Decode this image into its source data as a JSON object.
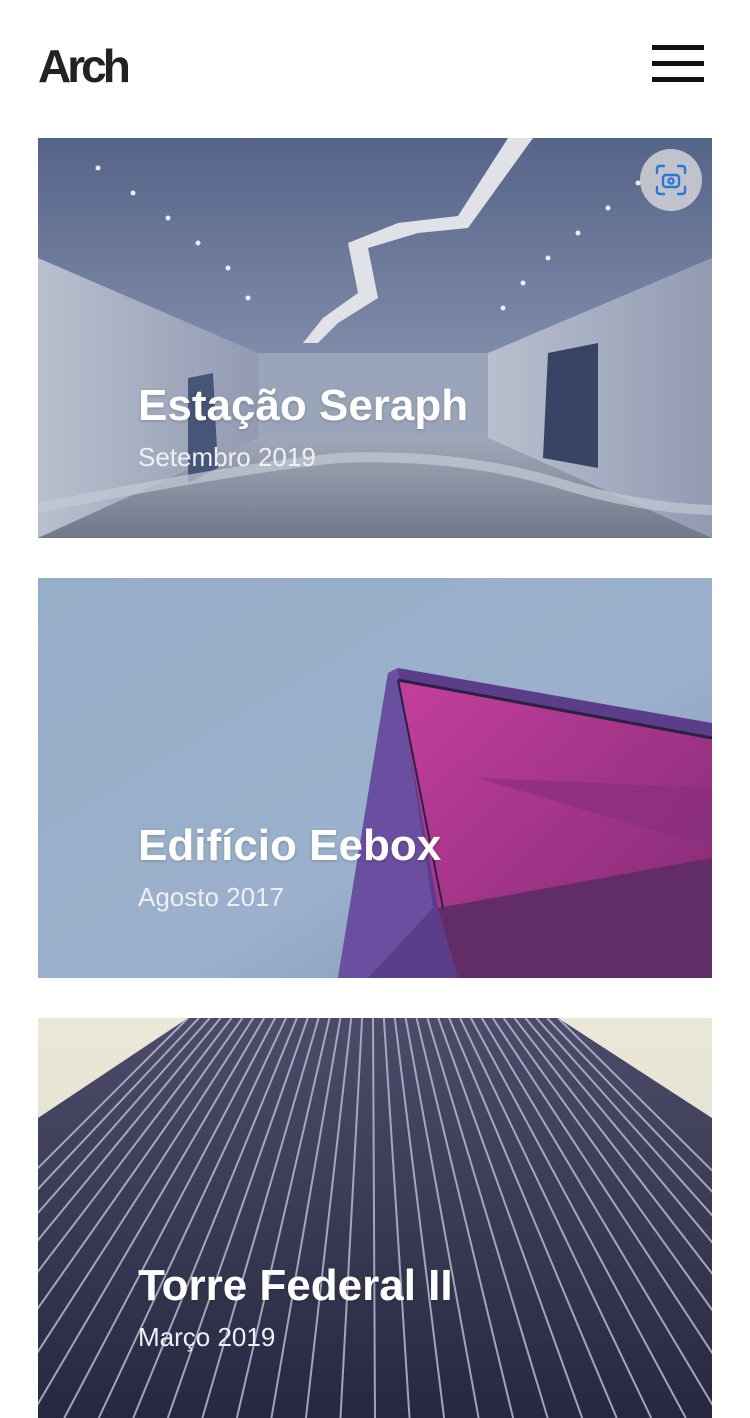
{
  "header": {
    "logo": "Arch",
    "menu_icon": "hamburger-icon"
  },
  "projects": [
    {
      "title": "Estação Seraph",
      "date": "Setembro 2019"
    },
    {
      "title": "Edifício Eebox",
      "date": "Agosto 2017"
    },
    {
      "title": "Torre Federal II",
      "date": "Março 2019"
    }
  ],
  "overlay": {
    "lens_icon": "screen-search-icon"
  },
  "colors": {
    "background": "#ffffff",
    "logo": "#222222",
    "card_text": "#ffffff"
  }
}
